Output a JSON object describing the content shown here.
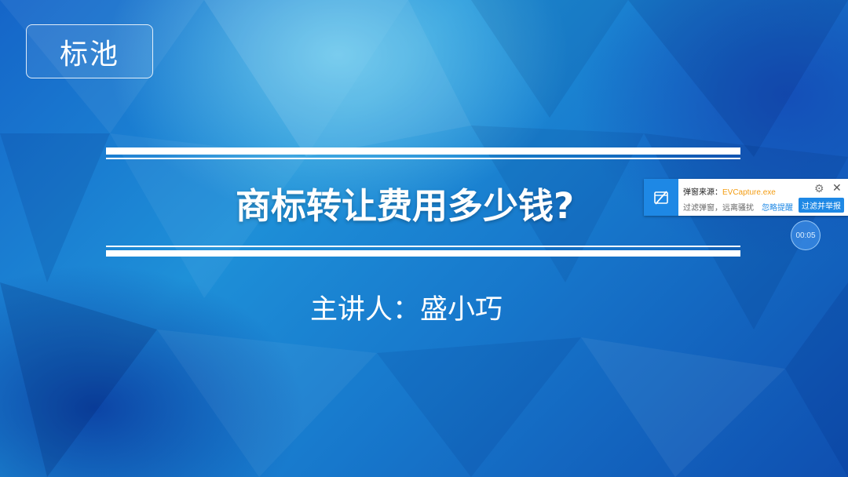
{
  "logo": {
    "label": "标池"
  },
  "slide": {
    "title": "商标转让费用多少钱?",
    "presenter": "主讲人：盛小巧"
  },
  "popup": {
    "source_label": "弹窗来源：",
    "source_value": "EVCapture.exe",
    "description": "过滤弹窗，远离骚扰",
    "ignore_label": "忽略提醒",
    "filter_button": "过滤并举报",
    "icon": "blocked-window-icon"
  },
  "timer": {
    "value": "00:05"
  },
  "colors": {
    "background": "#1778cc",
    "popup_accent": "#1e88e5",
    "source_highlight": "#f39c12"
  }
}
